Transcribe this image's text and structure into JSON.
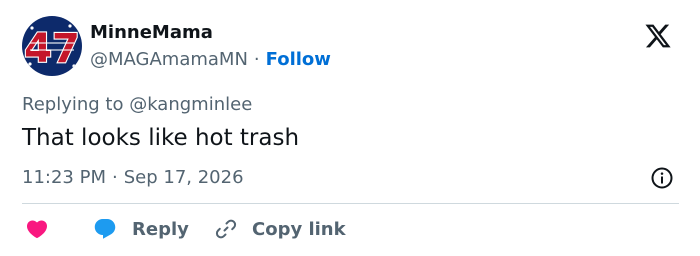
{
  "author": {
    "display_name": "MinneMama",
    "handle": "@MAGAmamaMN",
    "separator": "·",
    "follow_label": "Follow",
    "avatar_text": "47"
  },
  "reply_context": {
    "prefix": "Replying to ",
    "mention": "@kangminlee"
  },
  "tweet": {
    "text": "That looks like hot trash",
    "time": "11:23 PM",
    "separator": "·",
    "date": "Sep 17, 2026"
  },
  "actions": {
    "reply_label": "Reply",
    "copy_label": "Copy link"
  },
  "icons": {
    "logo": "x-logo-icon",
    "info": "info-icon",
    "like": "heart-icon",
    "reply": "speech-bubble-icon",
    "copy": "link-icon"
  },
  "colors": {
    "text_primary": "#0f1419",
    "text_secondary": "#536471",
    "follow": "#006fd6",
    "like": "#f91880",
    "reply": "#1d9bf0",
    "divider": "#cfd9de"
  }
}
